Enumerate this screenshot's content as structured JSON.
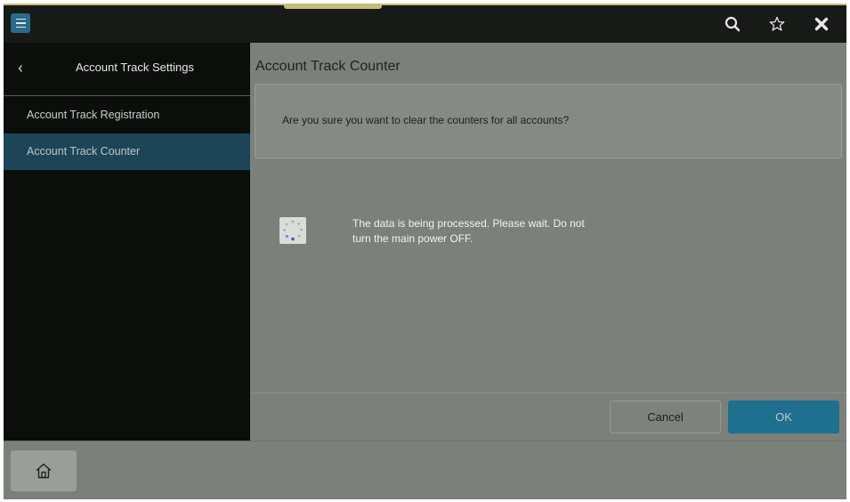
{
  "topbar": {
    "menu_icon": "hamburger-icon",
    "search_icon": "search-icon",
    "favorite_icon": "star-icon",
    "close_icon": "close-icon",
    "accent": "#2a6b87"
  },
  "sidebar": {
    "title": "Account Track Settings",
    "back_icon": "chevron-left-icon",
    "items": [
      {
        "label": "Account Track Registration",
        "selected": false
      },
      {
        "label": "Account Track Counter",
        "selected": true
      }
    ],
    "selected_color": "#1e4557"
  },
  "main": {
    "title": "Account Track Counter",
    "confirm_message": "Are you sure you want to clear the counters for all accounts?",
    "processing": {
      "icon": "loading-spinner-icon",
      "line1": "The data is being processed. Please wait. Do not",
      "line2": "turn the main power OFF."
    },
    "buttons": {
      "cancel": "Cancel",
      "ok": "OK",
      "ok_color": "#1f6f8e"
    }
  },
  "bottombar": {
    "home_icon": "home-icon"
  }
}
